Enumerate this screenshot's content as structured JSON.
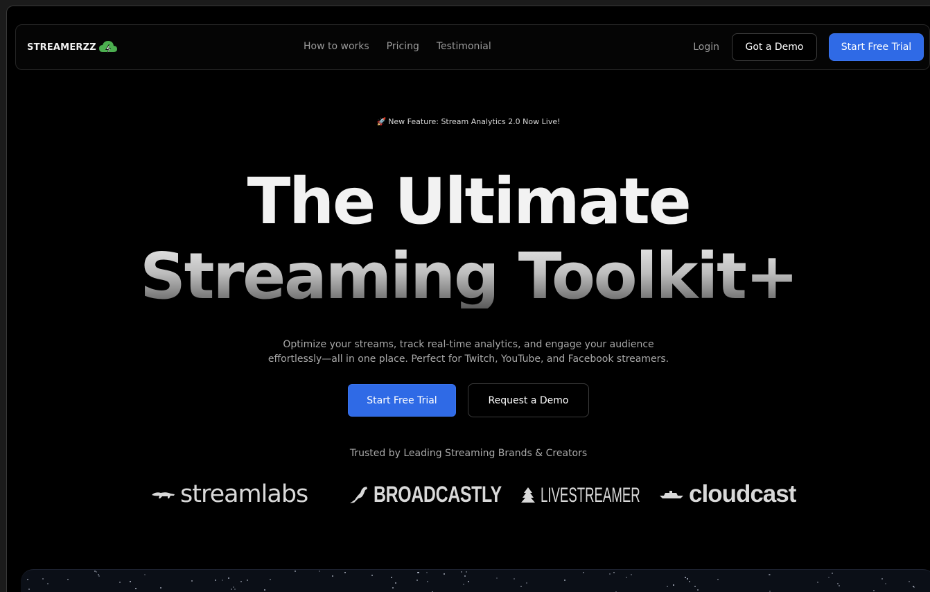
{
  "nav": {
    "logo_text": "STREAMERZZ",
    "links": [
      "How to works",
      "Pricing",
      "Testimonial"
    ],
    "login": "Login",
    "demo_button": "Got a Demo",
    "trial_button": "Start Free Trial"
  },
  "hero": {
    "badge_icon": "rocket-icon",
    "badge_text": "New Feature: Stream Analytics 2.0 Now Live!",
    "headline_line1": "The Ultimate",
    "headline_line2": "Streaming Toolkit+",
    "subtitle_line1": "Optimize your streams, track real-time analytics, and engage your audience",
    "subtitle_line2": "effortlessly—all in one place. Perfect for Twitch, YouTube, and Facebook streamers.",
    "cta_primary": "Start Free Trial",
    "cta_secondary": "Request a Demo"
  },
  "trusted": {
    "text": "Trusted by Leading Streaming Brands & Creators",
    "brands": [
      "streamlabs",
      "BROADCASTLY",
      "LIVESTREAMER",
      "cloudcast"
    ]
  },
  "colors": {
    "background": "#000000",
    "primary": "#2f6ae6",
    "logo_accent": "#4caf50"
  }
}
